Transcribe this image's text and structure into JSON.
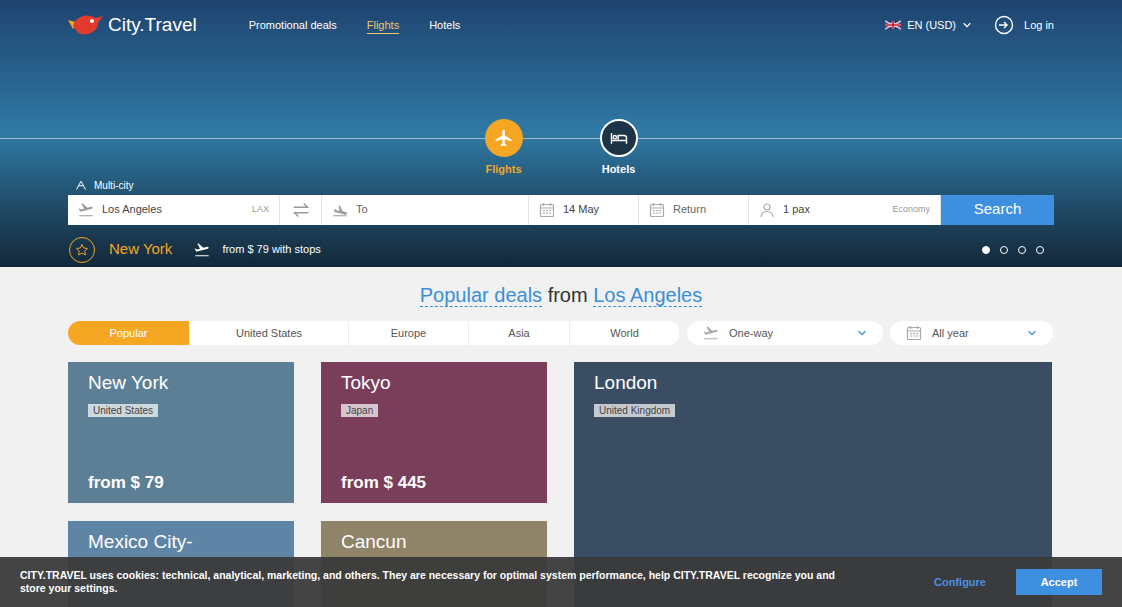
{
  "header": {
    "logo": "City.Travel",
    "nav": [
      {
        "label": "Promotional deals",
        "selected": false
      },
      {
        "label": "Flights",
        "selected": true
      },
      {
        "label": "Hotels",
        "selected": false
      }
    ],
    "language": "EN (USD)",
    "login": "Log in"
  },
  "hero": {
    "modes": [
      {
        "label": "Flights",
        "selected": true
      },
      {
        "label": "Hotels",
        "selected": false
      }
    ],
    "multi_city": "Multi-city",
    "search": {
      "origin": "Los Angeles",
      "origin_code": "LAX",
      "destination_placeholder": "To",
      "depart": "14 May",
      "return_placeholder": "Return",
      "passengers": "1 pax",
      "cabin": "Economy",
      "button": "Search"
    },
    "promo": {
      "city": "New York",
      "price": "from $ 79 with stops"
    },
    "slides": [
      {
        "selected": true
      },
      {
        "selected": false
      },
      {
        "selected": false
      },
      {
        "selected": false
      }
    ]
  },
  "deals": {
    "heading": [
      "Popular deals",
      "from",
      "Los Angeles"
    ],
    "tabs": [
      {
        "label": "Popular",
        "selected": true
      },
      {
        "label": "United States",
        "selected": false
      },
      {
        "label": "Europe",
        "selected": false
      },
      {
        "label": "Asia",
        "selected": false
      },
      {
        "label": "World",
        "selected": false
      }
    ],
    "trip_type": "One-way",
    "period": "All year",
    "cards": [
      {
        "city": "New York",
        "country": "United States",
        "price": "from $ 79"
      },
      {
        "city": "Tokyo",
        "country": "Japan",
        "price": "from $ 445"
      },
      {
        "city": "London",
        "country": "United Kingdom",
        "price": ""
      },
      {
        "city": "Mexico City-",
        "country": "",
        "price": ""
      },
      {
        "city": "Cancun",
        "country": "",
        "price": ""
      }
    ]
  },
  "cookie": {
    "text": "CITY.TRAVEL uses cookies: technical, analytical, marketing, and others. They are necessary for optimal system performance, help CITY.TRAVEL recognize you and store your settings.",
    "configure": "Configure",
    "accept": "Accept"
  }
}
